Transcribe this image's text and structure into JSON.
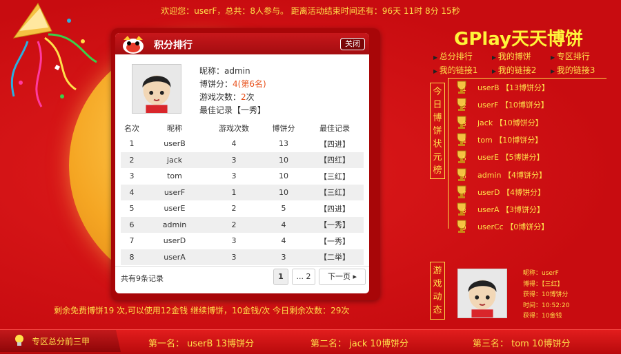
{
  "header": {
    "welcome": "欢迎您：userF，总共：8人参与。  距离活动结束时间还有：96天 11时 8分 15秒"
  },
  "panel": {
    "title": "积分排行",
    "close_label": "关闭",
    "me": {
      "nickname_line": "昵称：admin",
      "score_label": "博饼分：",
      "score_value": "4(第6名)",
      "plays_label": "游戏次数：",
      "plays_value": "2",
      "plays_unit": "次",
      "best_line": "最佳记录【一秀】"
    },
    "columns": [
      "名次",
      "昵称",
      "游戏次数",
      "博饼分",
      "最佳记录"
    ],
    "rows": [
      [
        "1",
        "userB",
        "4",
        "13",
        "【四进】"
      ],
      [
        "2",
        "jack",
        "3",
        "10",
        "【四红】"
      ],
      [
        "3",
        "tom",
        "3",
        "10",
        "【三红】"
      ],
      [
        "4",
        "userF",
        "1",
        "10",
        "【三红】"
      ],
      [
        "5",
        "userE",
        "2",
        "5",
        "【四进】"
      ],
      [
        "6",
        "admin",
        "2",
        "4",
        "【一秀】"
      ],
      [
        "7",
        "userD",
        "3",
        "4",
        "【一秀】"
      ],
      [
        "8",
        "userA",
        "3",
        "3",
        "【二举】"
      ]
    ],
    "total_text": "共有9条记录",
    "pagination": {
      "page1": "1",
      "page2": "... 2",
      "next": "下一页 ▸"
    }
  },
  "brand": "GPlay天天博饼",
  "nav": [
    "总分排行",
    "我的博饼",
    "专区排行",
    "我的链接1",
    "我的链接2",
    "我的链接3"
  ],
  "board_title": "今日博饼状元榜",
  "board": [
    "userB 【13博饼分】",
    "userF 【10博饼分】",
    "jack 【10博饼分】",
    "tom 【10博饼分】",
    "userE 【5博饼分】",
    "admin 【4博饼分】",
    "userD 【4博饼分】",
    "userA 【3博饼分】",
    "userCc 【0博饼分】"
  ],
  "board_ranks": [
    "1",
    "2",
    "3",
    "4",
    "5",
    "6",
    "7",
    "8",
    "9"
  ],
  "game_title": "游戏动态",
  "dynamic": {
    "nickname": "昵称：userF",
    "got": "博得：【三红】",
    "earned": "获得：10博饼分",
    "time": "时间：10:52:20",
    "coins": "获得：10金钱"
  },
  "bottom_note": "剩余免费博饼19 次,可以使用12金钱 继续博饼，10金钱/次 今日剩余次数：29次",
  "footer": {
    "tab_label": "专区总分前三甲",
    "first": "第一名： userB  13博饼分",
    "second": "第二名： jack  10博饼分",
    "third": "第三名： tom  10博饼分"
  },
  "colors": {
    "background": "#d11014",
    "gold_text": "#ffe04a",
    "brand_yellow": "#fff43a",
    "highlight": "#e8501a"
  }
}
